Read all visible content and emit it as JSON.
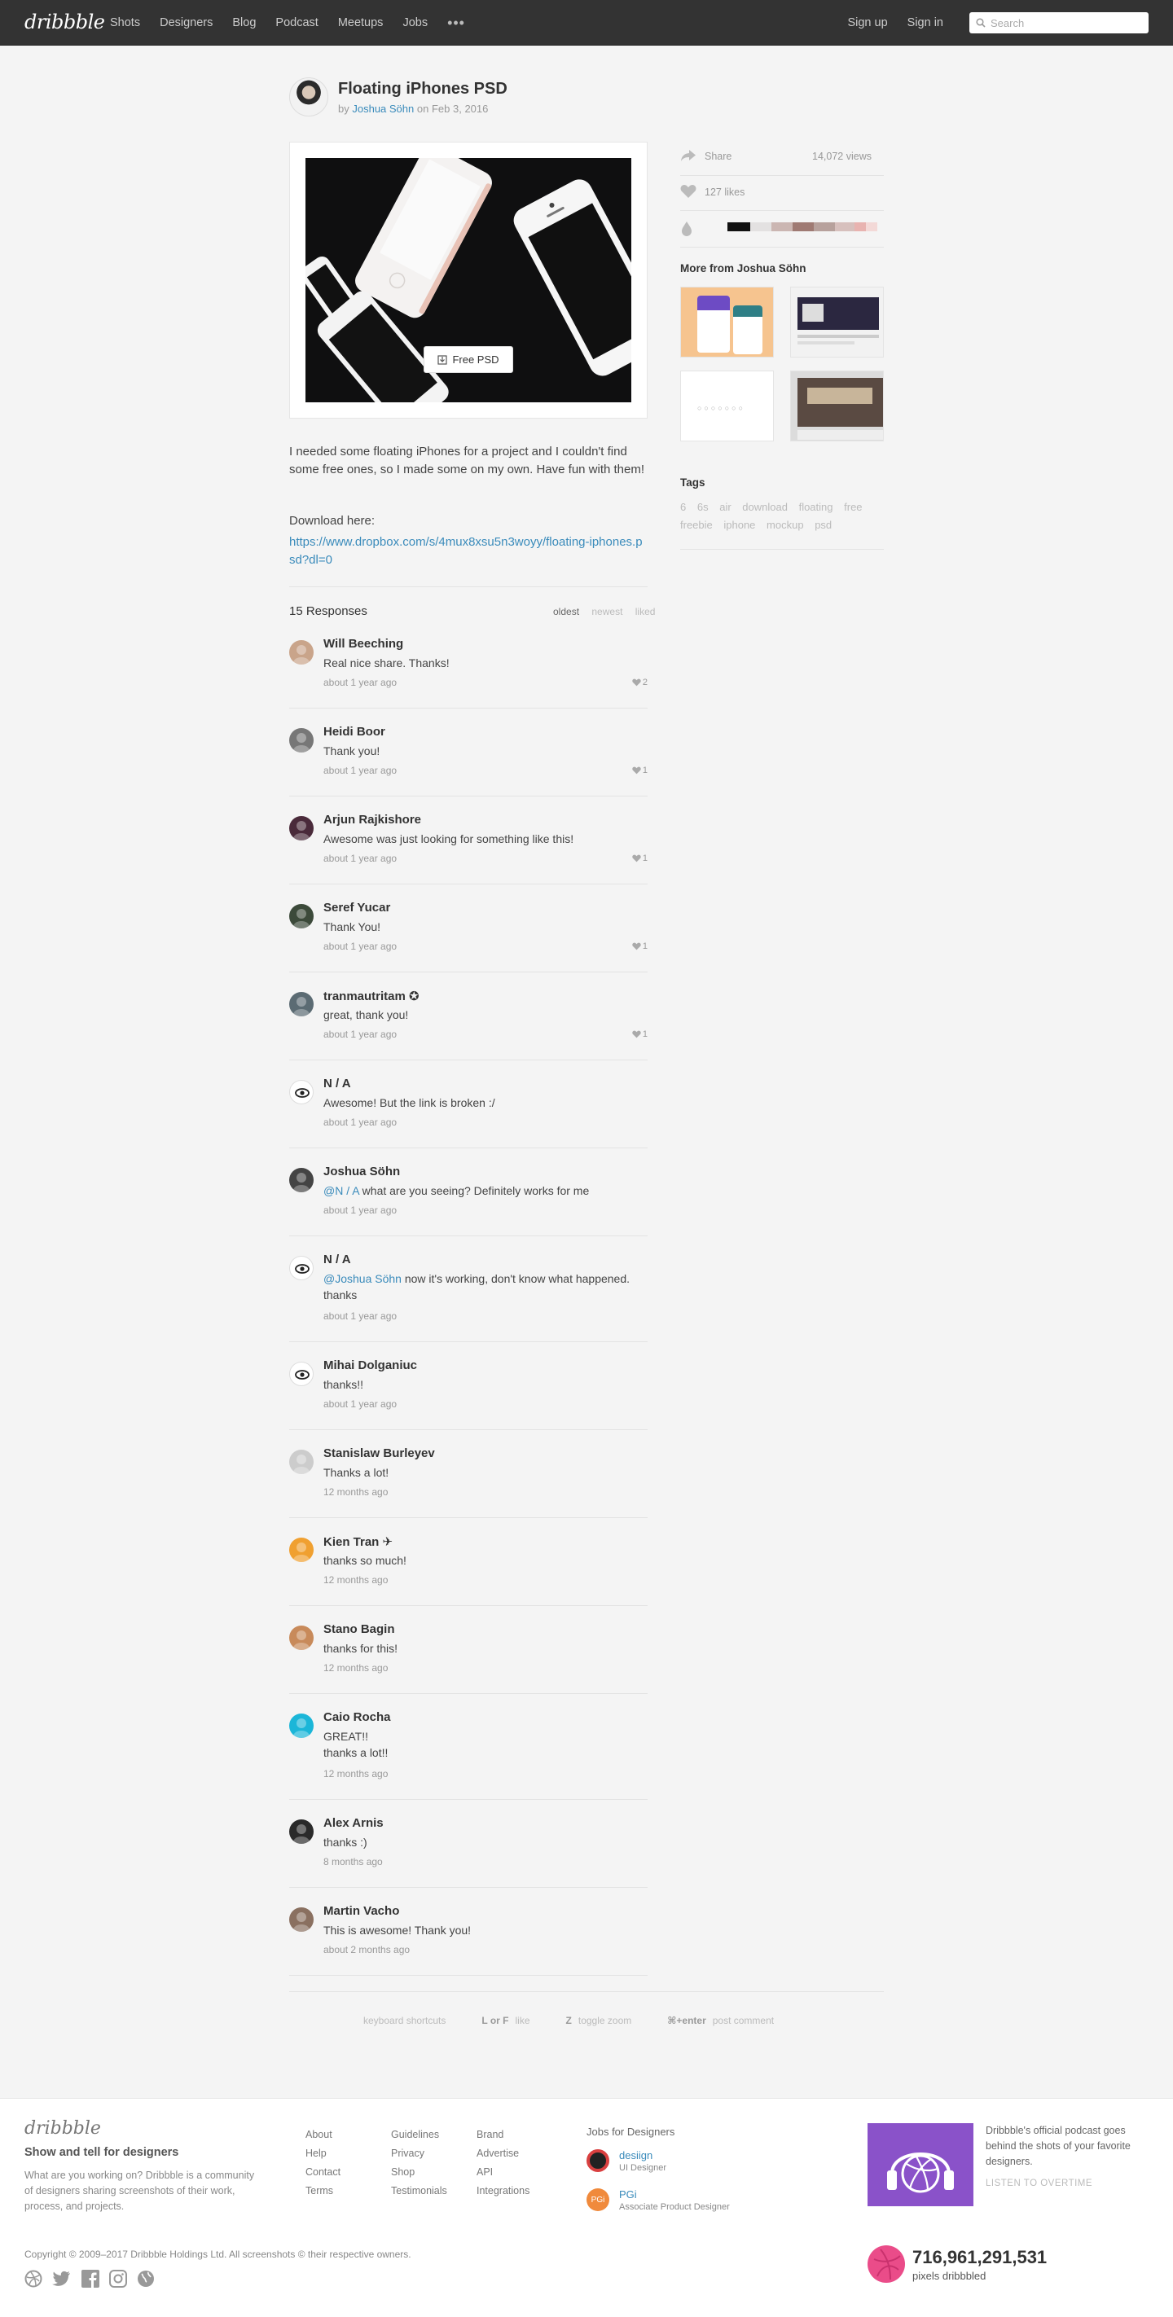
{
  "header": {
    "logo": "dribbble",
    "nav": [
      "Shots",
      "Designers",
      "Blog",
      "Podcast",
      "Meetups",
      "Jobs"
    ],
    "more": "•••",
    "signup": "Sign up",
    "signin": "Sign in",
    "search_placeholder": "Search"
  },
  "shot": {
    "title": "Floating iPhones PSD",
    "by": "by",
    "author": "Joshua Söhn",
    "on": "on",
    "date": "Feb 3, 2016",
    "download_button": "Free PSD",
    "description": "I needed some floating iPhones for a project and I couldn't find some free ones, so I made some on my own. Have fun with them!",
    "download_label": "Download here:",
    "download_link": "https://www.dropbox.com/s/4mux8xsu5n3woyy/floating-iphones.psd?dl=0"
  },
  "sidebar": {
    "share": "Share",
    "views": "14,072 views",
    "likes": "127 likes",
    "colors": [
      "#111111",
      "#e3e1e1",
      "#cbb6b2",
      "#9f7a73",
      "#b7a19c",
      "#d7c0bd",
      "#e8b3b0",
      "#f3d9d7"
    ],
    "more_from": "More from Joshua Söhn",
    "tags_title": "Tags",
    "tags": [
      "6",
      "6s",
      "air",
      "download",
      "floating",
      "free",
      "freebie",
      "iphone",
      "mockup",
      "psd"
    ]
  },
  "responses": {
    "count_label": "15 Responses",
    "sort": [
      "oldest",
      "newest",
      "liked"
    ],
    "items": [
      {
        "name": "Will Beeching",
        "text": "Real nice share. Thanks!",
        "time": "about 1 year ago",
        "likes": "2",
        "color": "#c9a48a"
      },
      {
        "name": "Heidi Boor",
        "text": "Thank you!",
        "time": "about 1 year ago",
        "likes": "1",
        "color": "#777777"
      },
      {
        "name": "Arjun Rajkishore",
        "text": "Awesome was just looking for something like this!",
        "time": "about 1 year ago",
        "likes": "1",
        "color": "#4a2a3a"
      },
      {
        "name": "Seref Yucar",
        "text": "Thank You!",
        "time": "about 1 year ago",
        "likes": "1",
        "color": "#3c4a3a"
      },
      {
        "name": "tranmautritam ✪",
        "text": "great, thank you!",
        "time": "about 1 year ago",
        "likes": "1",
        "color": "#5b6b73"
      },
      {
        "name": "N / A",
        "text": "Awesome! But the link is broken :/",
        "time": "about 1 year ago",
        "likes": "",
        "color": "#ffffff"
      },
      {
        "name": "Joshua Söhn",
        "mention": "@N / A",
        "text": " what are you seeing? Definitely works for me",
        "time": "about 1 year ago",
        "likes": "",
        "color": "#444444"
      },
      {
        "name": "N / A",
        "mention": "@Joshua Söhn",
        "text": " now it's working, don't know what happened. thanks",
        "time": "about 1 year ago",
        "likes": "",
        "color": "#ffffff"
      },
      {
        "name": "Mihai Dolganiuc",
        "text": "thanks!!",
        "time": "about 1 year ago",
        "likes": "",
        "color": "#ffffff"
      },
      {
        "name": "Stanislaw Burleyev",
        "text": "Thanks a lot!",
        "time": "12 months ago",
        "likes": "",
        "color": "#cccccc"
      },
      {
        "name": "Kien Tran ✈",
        "text": "thanks so much!",
        "time": "12 months ago",
        "likes": "",
        "color": "#f0a030"
      },
      {
        "name": "Stano Bagin",
        "text": "thanks for this!",
        "time": "12 months ago",
        "likes": "",
        "color": "#c88a5a"
      },
      {
        "name": "Caio Rocha",
        "text": "GREAT!!\nthanks a lot!!",
        "time": "12 months ago",
        "likes": "",
        "color": "#1bb6d8"
      },
      {
        "name": "Alex Arnis",
        "text": "thanks :)",
        "time": "8 months ago",
        "likes": "",
        "color": "#2a2a2a"
      },
      {
        "name": "Martin Vacho",
        "text": "This is awesome! Thank you!",
        "time": "about 2 months ago",
        "likes": "",
        "color": "#8a7060"
      }
    ]
  },
  "shortcuts": [
    {
      "keys": "keyboard shortcuts",
      "label": ""
    },
    {
      "keys": "L  or F",
      "label": "like"
    },
    {
      "keys": "Z",
      "label": "toggle zoom"
    },
    {
      "keys": "⌘+enter",
      "label": "post comment"
    }
  ],
  "footer": {
    "logo": "dribbble",
    "tagline": "Show and tell for designers",
    "description": "What are you working on? Dribbble is a community of designers sharing screenshots of their work, process, and projects.",
    "col1": [
      "About",
      "Help",
      "Contact",
      "Terms"
    ],
    "col2": [
      "Guidelines",
      "Privacy",
      "Shop",
      "Testimonials"
    ],
    "col3": [
      "Brand",
      "Advertise",
      "API",
      "Integrations"
    ],
    "jobs_title": "Jobs for Designers",
    "jobs": [
      {
        "company": "desiign",
        "role": "UI Designer",
        "logo_text": "",
        "color": "#222222"
      },
      {
        "company": "PGi",
        "role": "Associate Product Designer",
        "logo_text": "PGi",
        "color": "#f08a3c"
      }
    ],
    "podcast_text": "Dribbble's official podcast goes behind the shots of your favorite designers.",
    "podcast_link": "LISTEN TO OVERTIME",
    "copyright": "Copyright © 2009–2017 Dribbble Holdings Ltd. All screenshots © their respective owners.",
    "pixels_count": "716,961,291,531",
    "pixels_label": "pixels dribbbled"
  }
}
